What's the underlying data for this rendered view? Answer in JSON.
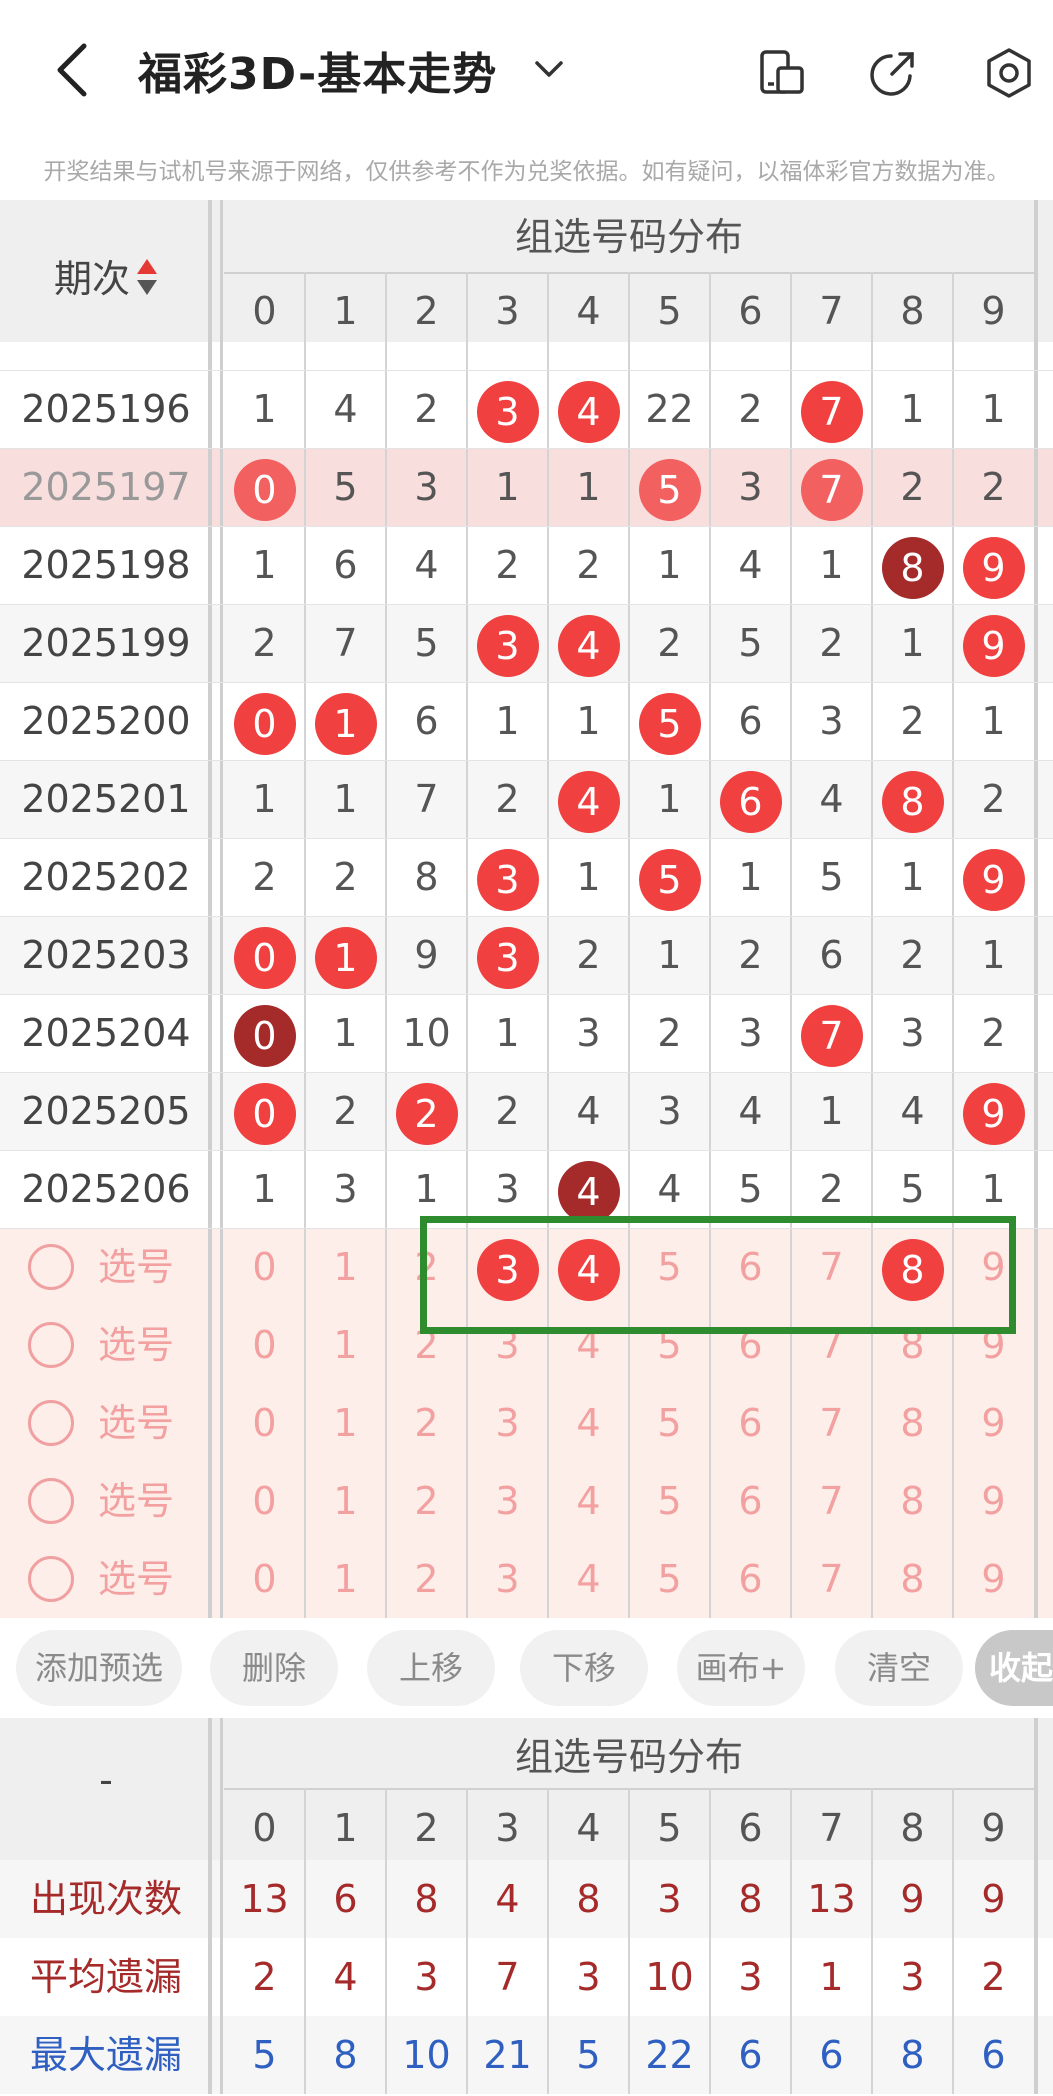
{
  "header": {
    "title": "福彩3D-基本走势",
    "icons": [
      "back-arrow-icon",
      "chevron-down-icon",
      "device-icon",
      "share-icon",
      "settings-gear-icon"
    ]
  },
  "notice": "开奖结果与试机号来源于网络，仅供参考不作为兑奖依据。如有疑问，以福体彩官方数据为准。",
  "table": {
    "period_header": "期次",
    "group_header": "组选号码分布",
    "digits": [
      "0",
      "1",
      "2",
      "3",
      "4",
      "5",
      "6",
      "7",
      "8",
      "9"
    ],
    "rows": [
      {
        "period": "2025196",
        "cells": [
          "1",
          "4",
          "2",
          "3",
          "4",
          "22",
          "2",
          "7",
          "1",
          "1"
        ],
        "balls": [
          3,
          4,
          7
        ],
        "dark": []
      },
      {
        "period": "2025197",
        "cells": [
          "0",
          "5",
          "3",
          "1",
          "1",
          "5",
          "3",
          "7",
          "2",
          "2"
        ],
        "balls": [
          0,
          5,
          7
        ],
        "dark": [],
        "highlight": true
      },
      {
        "period": "2025198",
        "cells": [
          "1",
          "6",
          "4",
          "2",
          "2",
          "1",
          "4",
          "1",
          "8",
          "9"
        ],
        "balls": [
          8,
          9
        ],
        "dark": [
          8
        ]
      },
      {
        "period": "2025199",
        "cells": [
          "2",
          "7",
          "5",
          "3",
          "4",
          "2",
          "5",
          "2",
          "1",
          "9"
        ],
        "balls": [
          3,
          4,
          9
        ],
        "dark": []
      },
      {
        "period": "2025200",
        "cells": [
          "0",
          "1",
          "6",
          "1",
          "1",
          "5",
          "6",
          "3",
          "2",
          "1"
        ],
        "balls": [
          0,
          1,
          5
        ],
        "dark": []
      },
      {
        "period": "2025201",
        "cells": [
          "1",
          "1",
          "7",
          "2",
          "4",
          "1",
          "6",
          "4",
          "8",
          "2"
        ],
        "balls": [
          4,
          6,
          8
        ],
        "dark": []
      },
      {
        "period": "2025202",
        "cells": [
          "2",
          "2",
          "8",
          "3",
          "1",
          "5",
          "1",
          "5",
          "1",
          "9"
        ],
        "balls": [
          3,
          5,
          9
        ],
        "dark": []
      },
      {
        "period": "2025203",
        "cells": [
          "0",
          "1",
          "9",
          "3",
          "2",
          "1",
          "2",
          "6",
          "2",
          "1"
        ],
        "balls": [
          0,
          1,
          3
        ],
        "dark": []
      },
      {
        "period": "2025204",
        "cells": [
          "0",
          "1",
          "10",
          "1",
          "3",
          "2",
          "3",
          "7",
          "3",
          "2"
        ],
        "balls": [
          0,
          7
        ],
        "dark": [
          0
        ]
      },
      {
        "period": "2025205",
        "cells": [
          "0",
          "2",
          "2",
          "2",
          "4",
          "3",
          "4",
          "1",
          "4",
          "9"
        ],
        "balls": [
          0,
          2,
          9
        ],
        "dark": []
      },
      {
        "period": "2025206",
        "cells": [
          "1",
          "3",
          "1",
          "3",
          "4",
          "4",
          "5",
          "2",
          "5",
          "1"
        ],
        "balls": [
          4
        ],
        "dark": [
          4
        ]
      }
    ]
  },
  "selection": {
    "label": "选号",
    "rows": [
      {
        "selected": [
          3,
          4,
          8
        ]
      },
      {
        "selected": []
      },
      {
        "selected": []
      },
      {
        "selected": []
      },
      {
        "selected": []
      }
    ]
  },
  "actions": [
    "添加预选",
    "删除",
    "上移",
    "下移",
    "画布+",
    "清空",
    "收起"
  ],
  "stats": {
    "dash": "-",
    "group_header": "组选号码分布",
    "rows": [
      {
        "label": "出现次数",
        "values": [
          "13",
          "6",
          "8",
          "4",
          "8",
          "3",
          "8",
          "13",
          "9",
          "9"
        ],
        "color": "#a52a2a"
      },
      {
        "label": "平均遗漏",
        "values": [
          "2",
          "4",
          "3",
          "7",
          "3",
          "10",
          "3",
          "1",
          "3",
          "2"
        ],
        "color": "#a52a2a"
      },
      {
        "label": "最大遗漏",
        "values": [
          "5",
          "8",
          "10",
          "21",
          "5",
          "22",
          "6",
          "6",
          "8",
          "6"
        ],
        "color": "#2f5fc0"
      }
    ]
  },
  "colors": {
    "ball": "#f04040",
    "ball_dark": "#a52a2a",
    "highlight_row": "#f9dede",
    "selection_bg": "#fdeeea",
    "green_box": "#2e8b2e"
  }
}
